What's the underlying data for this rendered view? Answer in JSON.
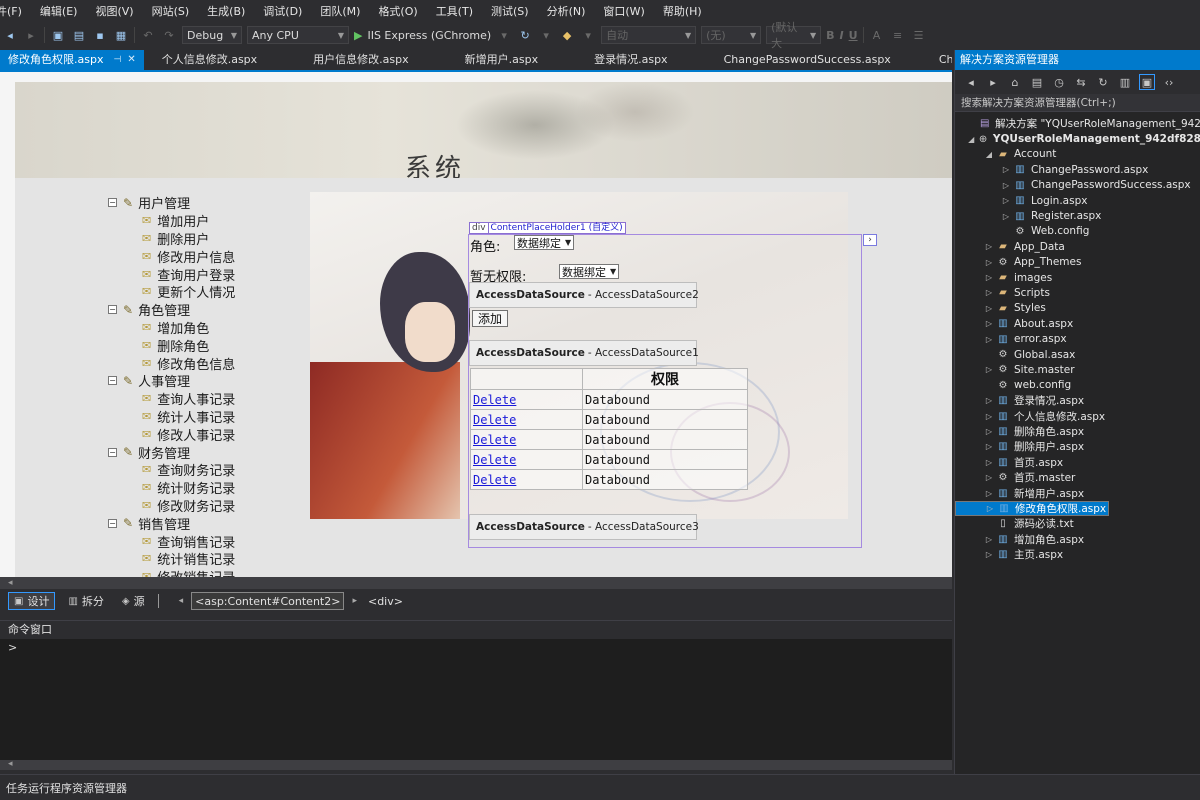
{
  "menu": [
    "件(F)",
    "编辑(E)",
    "视图(V)",
    "网站(S)",
    "生成(B)",
    "调试(D)",
    "团队(M)",
    "格式(O)",
    "工具(T)",
    "测试(S)",
    "分析(N)",
    "窗口(W)",
    "帮助(H)"
  ],
  "toolbar": {
    "config": "Debug",
    "platform": "Any CPU",
    "run_label": "IIS Express (GChrome)",
    "style_combo": "自动",
    "font_combo": "(无)",
    "size_combo": "(默认大",
    "format_buttons": [
      "B",
      "I",
      "U"
    ]
  },
  "doc_tabs": [
    {
      "label": "修改角色权限.aspx",
      "active": true
    },
    {
      "label": "个人信息修改.aspx",
      "active": false
    },
    {
      "label": "用户信息修改.aspx",
      "active": false
    },
    {
      "label": "新增用户.aspx",
      "active": false
    },
    {
      "label": "登录情况.aspx",
      "active": false
    },
    {
      "label": "ChangePasswordSuccess.aspx",
      "active": false
    },
    {
      "label": "ChangePas",
      "active": false
    }
  ],
  "page": {
    "banner_title": "系统",
    "nav": [
      {
        "label": "用户管理",
        "items": [
          "增加用户",
          "删除用户",
          "修改用户信息",
          "查询用户登录",
          "更新个人情况"
        ]
      },
      {
        "label": "角色管理",
        "items": [
          "增加角色",
          "删除角色",
          "修改角色信息"
        ]
      },
      {
        "label": "人事管理",
        "items": [
          "查询人事记录",
          "统计人事记录",
          "修改人事记录"
        ]
      },
      {
        "label": "财务管理",
        "items": [
          "查询财务记录",
          "统计财务记录",
          "修改财务记录"
        ]
      },
      {
        "label": "销售管理",
        "items": [
          "查询销售记录",
          "统计销售记录",
          "修改销售记录"
        ]
      }
    ],
    "cph": {
      "tag_div": "div",
      "tag_label": "ContentPlaceHolder1 (自定义)",
      "role_label": "角色:",
      "role_select": "数据绑定",
      "perm_label": "暂无权限:",
      "perm_select": "数据绑定",
      "ads2_name": "AccessDataSource",
      "ads2_id": "- AccessDataSource2",
      "add_button": "添加",
      "ads1_name": "AccessDataSource",
      "ads1_id": "- AccessDataSource1",
      "grid_header": "权限",
      "grid_rows": [
        {
          "link": "Delete",
          "value": "Databound"
        },
        {
          "link": "Delete",
          "value": "Databound"
        },
        {
          "link": "Delete",
          "value": "Databound"
        },
        {
          "link": "Delete",
          "value": "Databound"
        },
        {
          "link": "Delete",
          "value": "Databound"
        }
      ],
      "ads3_name": "AccessDataSource",
      "ads3_id": "- AccessDataSource3"
    }
  },
  "viewbar": {
    "design": "设计",
    "split": "拆分",
    "source": "源",
    "crumbs": [
      "<asp:Content#Content2>",
      "<div>"
    ]
  },
  "command_window": {
    "title": "命令窗口",
    "prompt": ">"
  },
  "status": {
    "text": "任务运行程序资源管理器"
  },
  "solution_explorer": {
    "title": "解决方案资源管理器",
    "search": "搜索解决方案资源管理器(Ctrl+;)",
    "tree": [
      {
        "label": "解决方案 \"YQUserRoleManagement_942",
        "indent": 0,
        "icon": "sln",
        "exp": "",
        "bold": false,
        "selected": false
      },
      {
        "label": "YQUserRoleManagement_942df828",
        "indent": 0,
        "icon": "globe",
        "exp": "◢",
        "bold": true,
        "selected": false
      },
      {
        "label": "Account",
        "indent": 1,
        "icon": "folder",
        "exp": "◢",
        "bold": false,
        "selected": false
      },
      {
        "label": "ChangePassword.aspx",
        "indent": 2,
        "icon": "page",
        "exp": "▷",
        "bold": false,
        "selected": false
      },
      {
        "label": "ChangePasswordSuccess.aspx",
        "indent": 2,
        "icon": "page",
        "exp": "▷",
        "bold": false,
        "selected": false
      },
      {
        "label": "Login.aspx",
        "indent": 2,
        "icon": "page",
        "exp": "▷",
        "bold": false,
        "selected": false
      },
      {
        "label": "Register.aspx",
        "indent": 2,
        "icon": "page",
        "exp": "▷",
        "bold": false,
        "selected": false
      },
      {
        "label": "Web.config",
        "indent": 2,
        "icon": "cfg",
        "exp": "",
        "bold": false,
        "selected": false
      },
      {
        "label": "App_Data",
        "indent": 1,
        "icon": "folder",
        "exp": "▷",
        "bold": false,
        "selected": false
      },
      {
        "label": "App_Themes",
        "indent": 1,
        "icon": "cfg",
        "exp": "▷",
        "bold": false,
        "selected": false
      },
      {
        "label": "images",
        "indent": 1,
        "icon": "folder",
        "exp": "▷",
        "bold": false,
        "selected": false
      },
      {
        "label": "Scripts",
        "indent": 1,
        "icon": "folder",
        "exp": "▷",
        "bold": false,
        "selected": false
      },
      {
        "label": "Styles",
        "indent": 1,
        "icon": "folder",
        "exp": "▷",
        "bold": false,
        "selected": false
      },
      {
        "label": "About.aspx",
        "indent": 1,
        "icon": "page",
        "exp": "▷",
        "bold": false,
        "selected": false
      },
      {
        "label": "error.aspx",
        "indent": 1,
        "icon": "page",
        "exp": "▷",
        "bold": false,
        "selected": false
      },
      {
        "label": "Global.asax",
        "indent": 1,
        "icon": "cfg",
        "exp": "",
        "bold": false,
        "selected": false
      },
      {
        "label": "Site.master",
        "indent": 1,
        "icon": "cfg",
        "exp": "▷",
        "bold": false,
        "selected": false
      },
      {
        "label": "web.config",
        "indent": 1,
        "icon": "cfg",
        "exp": "",
        "bold": false,
        "selected": false
      },
      {
        "label": "登录情况.aspx",
        "indent": 1,
        "icon": "page",
        "exp": "▷",
        "bold": false,
        "selected": false
      },
      {
        "label": "个人信息修改.aspx",
        "indent": 1,
        "icon": "page",
        "exp": "▷",
        "bold": false,
        "selected": false
      },
      {
        "label": "删除角色.aspx",
        "indent": 1,
        "icon": "page",
        "exp": "▷",
        "bold": false,
        "selected": false
      },
      {
        "label": "删除用户.aspx",
        "indent": 1,
        "icon": "page",
        "exp": "▷",
        "bold": false,
        "selected": false
      },
      {
        "label": "首页.aspx",
        "indent": 1,
        "icon": "page",
        "exp": "▷",
        "bold": false,
        "selected": false
      },
      {
        "label": "首页.master",
        "indent": 1,
        "icon": "cfg",
        "exp": "▷",
        "bold": false,
        "selected": false
      },
      {
        "label": "新增用户.aspx",
        "indent": 1,
        "icon": "page",
        "exp": "▷",
        "bold": false,
        "selected": false
      },
      {
        "label": "修改角色权限.aspx",
        "indent": 1,
        "icon": "page",
        "exp": "▷",
        "bold": false,
        "selected": true
      },
      {
        "label": "用户信息修改.aspx",
        "indent": 1,
        "icon": "page",
        "exp": "▷",
        "bold": false,
        "selected": false
      },
      {
        "label": "源码必读.txt",
        "indent": 1,
        "icon": "txt",
        "exp": "",
        "bold": false,
        "selected": false
      },
      {
        "label": "增加角色.aspx",
        "indent": 1,
        "icon": "page",
        "exp": "▷",
        "bold": false,
        "selected": false
      },
      {
        "label": "主页.aspx",
        "indent": 1,
        "icon": "page",
        "exp": "▷",
        "bold": false,
        "selected": false
      }
    ]
  },
  "colors": {
    "accent": "#007acc",
    "link": "#1a1ad9",
    "cph_border": "#a58ae0"
  }
}
